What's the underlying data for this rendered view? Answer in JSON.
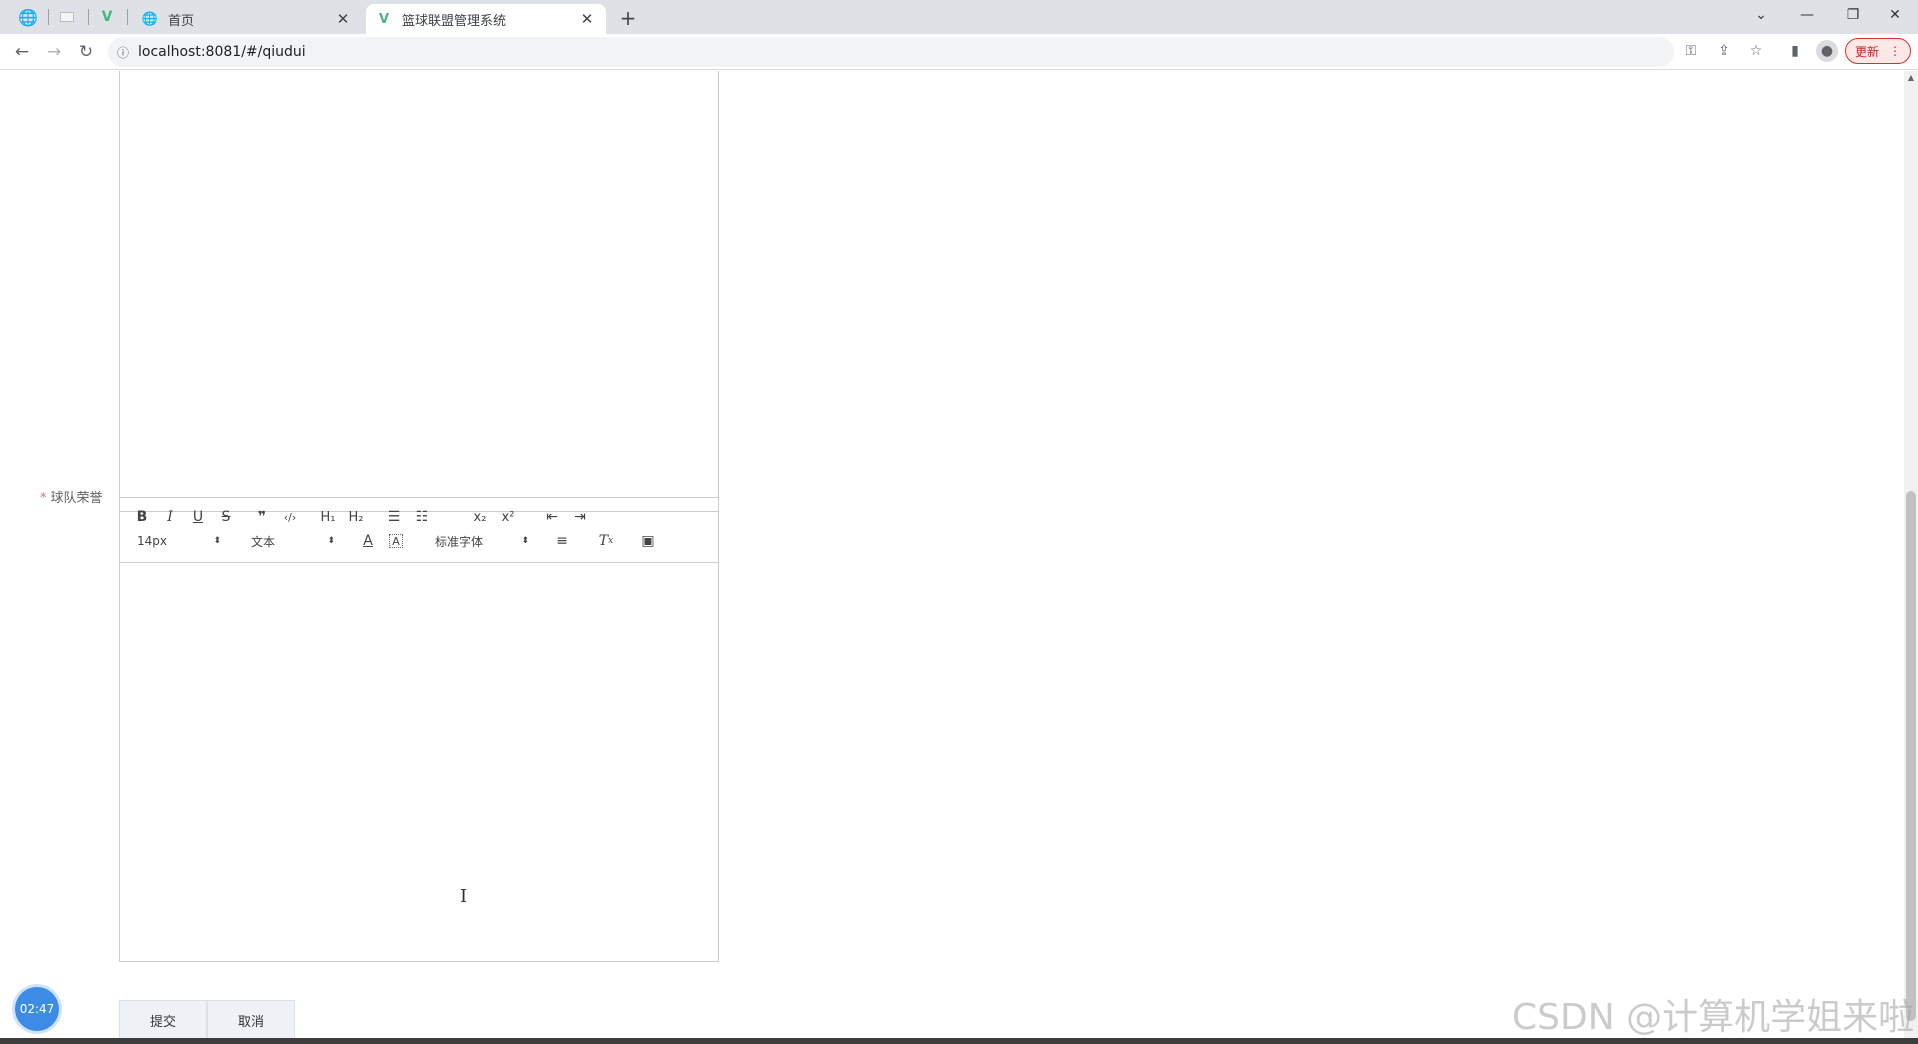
{
  "browser": {
    "tabs": [
      {
        "title": "首页"
      },
      {
        "title": "篮球联盟管理系统"
      }
    ],
    "url": "localhost:8081/#/qiudui",
    "update_label": "更新"
  },
  "form": {
    "honor_label": "球队荣誉",
    "required_mark": "*",
    "toolbar": {
      "font_size": "14px",
      "header_select": "文本",
      "font_family": "标准字体"
    },
    "submit_label": "提交",
    "cancel_label": "取消"
  },
  "timer": "02:47",
  "watermark": "CSDN @计算机学姐来啦",
  "colors": {
    "accent": "#3c8ce7",
    "required": "#f56c6c",
    "update_badge": "#c5221f"
  }
}
